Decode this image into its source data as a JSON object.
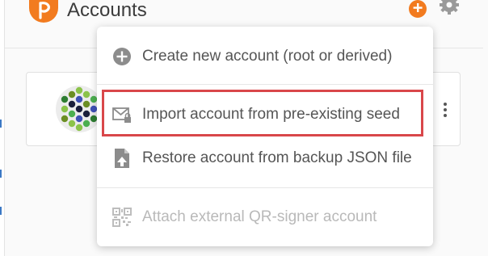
{
  "header": {
    "title": "Accounts",
    "logo_icon": "polkadot-js-logo",
    "add_icon": "plus-circle-icon",
    "settings_icon": "gear-icon",
    "accent": "#f27b1f"
  },
  "account": {
    "identicon": "identicon",
    "menu_icon": "kebab-menu-icon"
  },
  "menu": {
    "items": [
      {
        "label": "Create new account (root or derived)",
        "icon": "plus-circle-icon",
        "enabled": true
      },
      {
        "label": "Import account from pre-existing seed",
        "icon": "envelope-lock-icon",
        "enabled": true,
        "highlighted": true
      },
      {
        "label": "Restore account from backup JSON file",
        "icon": "file-upload-icon",
        "enabled": true
      },
      {
        "label": "Attach external QR-signer account",
        "icon": "qr-code-icon",
        "enabled": false
      }
    ],
    "highlight_color": "#d9474a"
  }
}
